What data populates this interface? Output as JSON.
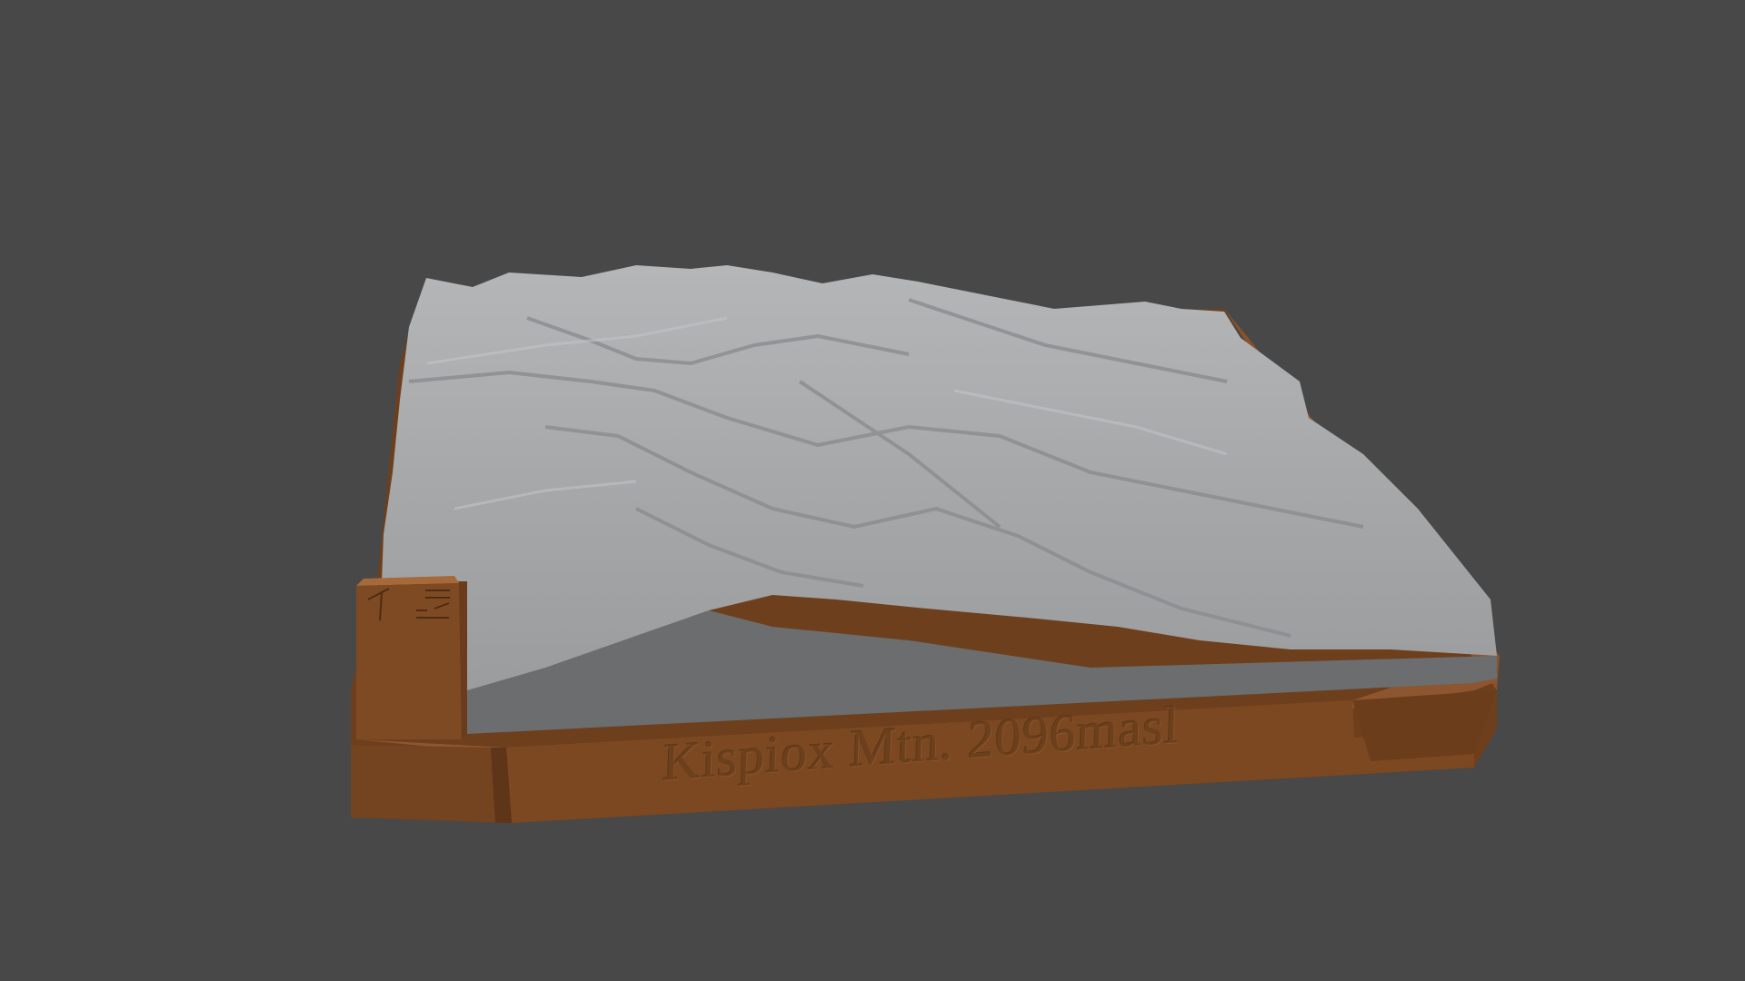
{
  "scene": {
    "plaque_text": "Kispiox Mtn. 2096masl",
    "colors": {
      "background": "#484848",
      "terrain": "#a9abad",
      "terrain_shadow": "#7e8082",
      "cross_section": "#6b6d6e",
      "base": "#7e4a24",
      "base_dark": "#5e3518",
      "base_light": "#8e5630"
    }
  }
}
